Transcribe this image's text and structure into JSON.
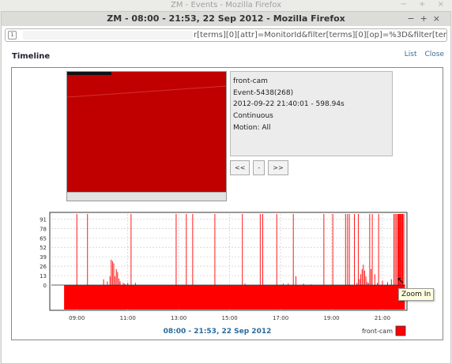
{
  "outer_window_title": "ZM - Events - Mozilla Firefox",
  "window_title": "ZM - 08:00 - 21:53, 22 Sep 2012 - Mozilla Firefox",
  "window_controls": [
    "−",
    "+",
    "×"
  ],
  "url_text": "r[terms][0][attr]=MonitorId&filter[terms][0][op]=%3D&filter[terms][",
  "page": {
    "title": "Timeline",
    "links": {
      "list": "List",
      "close": "Close"
    }
  },
  "event_info": {
    "monitor": "front-cam",
    "event": "Event-5438(268)",
    "time": "2012-09-22 21:40:01 - 598.94s",
    "mode": "Continuous",
    "motion": "Motion: All"
  },
  "nav": {
    "prev": "<<",
    "mid": "-",
    "next": ">>"
  },
  "tooltip": "Zoom In",
  "chart_data": {
    "type": "bar",
    "y_ticks": [
      "91",
      "78",
      "65",
      "52",
      "39",
      "26",
      "13",
      "0"
    ],
    "y_tick_values": [
      91,
      78,
      65,
      52,
      39,
      26,
      13,
      0
    ],
    "ylim": [
      0,
      98
    ],
    "x_ticks": [
      "09:00",
      "11:00",
      "13:00",
      "15:00",
      "17:00",
      "19:00",
      "21:00"
    ],
    "x_tick_values": [
      9,
      11,
      13,
      15,
      17,
      19,
      21
    ],
    "xlim": [
      8.0,
      21.9
    ],
    "xlabel": "08:00 - 21:53, 22 Sep 2012",
    "legend": "front-cam",
    "legend_position": "bottom-right",
    "series_color": "#ff0000",
    "events_start": 8.5,
    "events_end": 21.88,
    "event_scores": [
      [
        9.0,
        98
      ],
      [
        9.42,
        98
      ],
      [
        10.05,
        8
      ],
      [
        10.2,
        5
      ],
      [
        10.3,
        12
      ],
      [
        10.35,
        35
      ],
      [
        10.4,
        33
      ],
      [
        10.45,
        30
      ],
      [
        10.5,
        12
      ],
      [
        10.55,
        22
      ],
      [
        10.6,
        18
      ],
      [
        10.65,
        9
      ],
      [
        10.7,
        5
      ],
      [
        10.82,
        3
      ],
      [
        10.88,
        2
      ],
      [
        11.0,
        3
      ],
      [
        11.13,
        98
      ],
      [
        11.3,
        3
      ],
      [
        12.9,
        98
      ],
      [
        13.3,
        98
      ],
      [
        13.55,
        98
      ],
      [
        14.42,
        98
      ],
      [
        15.5,
        98
      ],
      [
        15.6,
        2
      ],
      [
        16.2,
        98
      ],
      [
        16.3,
        98
      ],
      [
        16.85,
        98
      ],
      [
        17.1,
        2
      ],
      [
        17.3,
        2
      ],
      [
        17.5,
        98
      ],
      [
        17.6,
        12
      ],
      [
        17.9,
        2
      ],
      [
        18.2,
        1
      ],
      [
        18.7,
        98
      ],
      [
        19.05,
        98
      ],
      [
        19.55,
        98
      ],
      [
        19.63,
        98
      ],
      [
        19.7,
        98
      ],
      [
        19.9,
        98
      ],
      [
        20.0,
        3
      ],
      [
        20.05,
        98
      ],
      [
        20.1,
        8
      ],
      [
        20.15,
        15
      ],
      [
        20.2,
        22
      ],
      [
        20.25,
        28
      ],
      [
        20.3,
        20
      ],
      [
        20.35,
        12
      ],
      [
        20.4,
        4
      ],
      [
        20.45,
        3
      ],
      [
        20.5,
        98
      ],
      [
        20.55,
        22
      ],
      [
        20.6,
        98
      ],
      [
        20.7,
        15
      ],
      [
        20.8,
        3
      ],
      [
        20.85,
        98
      ],
      [
        21.0,
        6
      ],
      [
        21.2,
        4
      ],
      [
        21.35,
        8
      ],
      [
        21.45,
        98
      ],
      [
        21.5,
        98
      ],
      [
        21.55,
        98
      ],
      [
        21.6,
        98
      ],
      [
        21.62,
        98
      ],
      [
        21.65,
        98
      ],
      [
        21.68,
        98
      ],
      [
        21.7,
        98
      ],
      [
        21.72,
        98
      ],
      [
        21.75,
        98
      ],
      [
        21.78,
        98
      ],
      [
        21.8,
        98
      ],
      [
        21.84,
        98
      ]
    ]
  }
}
